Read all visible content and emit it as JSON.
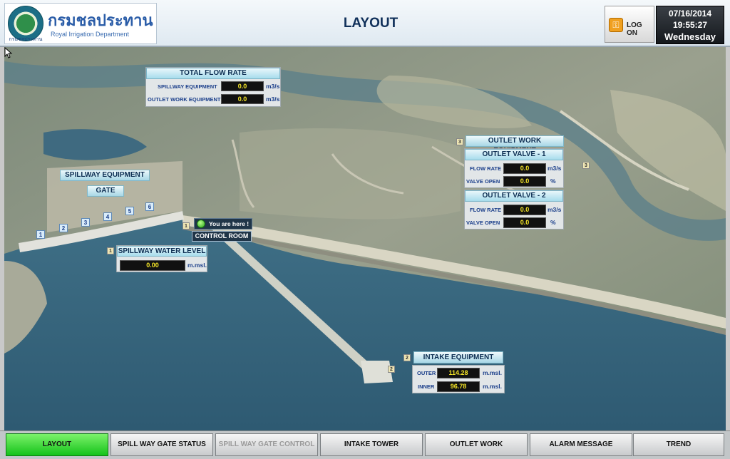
{
  "header": {
    "org_thai": "กรมชลประทาน",
    "org_english": "Royal Irrigation Department",
    "seal_text": "กรมชลประทาน",
    "title": "LAYOUT",
    "logon_label": "LOG ON",
    "date": "07/16/2014",
    "time": "19:55:27",
    "weekday": "Wednesday"
  },
  "total_flow": {
    "title": "TOTAL FLOW RATE",
    "rows": [
      {
        "label": "SPILLWAY EQUIPMENT",
        "value": "0.0",
        "unit": "m3/s"
      },
      {
        "label": "OUTLET WORK EQUIPMENT",
        "value": "0.0",
        "unit": "m3/s"
      }
    ]
  },
  "spillway": {
    "title": "SPILLWAY EQUIPMENT",
    "gate_label": "GATE",
    "gates": [
      "1",
      "2",
      "3",
      "4",
      "5",
      "6"
    ],
    "water_level": {
      "tag": "1",
      "title": "SPILLWAY WATER LEVEL",
      "value": "0.00",
      "unit": "m.msl."
    }
  },
  "control_room": {
    "tag": "1",
    "here_label": "You are here !",
    "label": "CONTROL ROOM"
  },
  "outlet_work": {
    "tag": "3",
    "map_tag": "3",
    "title": "OUTLET WORK EQUIPMENT",
    "valves": [
      {
        "title": "OUTLET VALVE - 1",
        "rows": [
          {
            "label": "FLOW RATE",
            "value": "0.0",
            "unit": "m3/s"
          },
          {
            "label": "VALVE OPEN",
            "value": "0.0",
            "unit": "%"
          }
        ]
      },
      {
        "title": "OUTLET VALVE - 2",
        "rows": [
          {
            "label": "FLOW RATE",
            "value": "0.0",
            "unit": "m3/s"
          },
          {
            "label": "VALVE OPEN",
            "value": "0.0",
            "unit": "%"
          }
        ]
      }
    ]
  },
  "intake": {
    "tag": "2",
    "map_tag": "2",
    "title": "INTAKE EQUIPMENT",
    "rows": [
      {
        "label": "OUTER",
        "value": "114.28",
        "unit": "m.msl."
      },
      {
        "label": "INNER",
        "value": "96.78",
        "unit": "m.msl."
      }
    ]
  },
  "nav": {
    "items": [
      "LAYOUT",
      "SPILL WAY GATE STATUS",
      "SPILL WAY GATE CONTROL",
      "INTAKE TOWER",
      "OUTLET WORK",
      "ALARM MESSAGE",
      "TREND"
    ],
    "active": "LAYOUT",
    "disabled": "SPILL WAY GATE CONTROL"
  },
  "colors": {
    "accent": "#14c21a",
    "value_text": "#f6e628",
    "header_text": "#10305a"
  },
  "icons": [
    "royal-irrigation-seal-icon",
    "key-icon",
    "status-green-dot-icon",
    "mouse-cursor-icon"
  ]
}
